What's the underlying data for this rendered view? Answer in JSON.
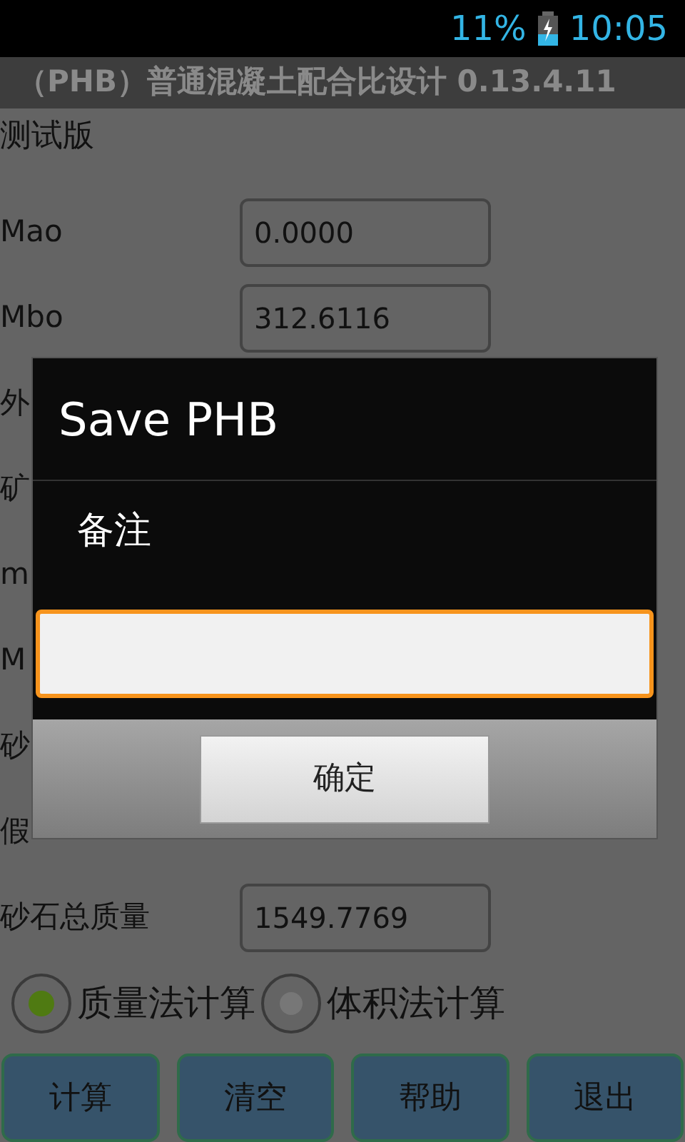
{
  "status_bar": {
    "battery": "11%",
    "time": "10:05"
  },
  "title": "（PHB）普通混凝土配合比设计 0.13.4.11",
  "subtitle": "测试版",
  "rows": [
    {
      "label": "Mao",
      "value": "0.0000"
    },
    {
      "label": "Mbo",
      "value": "312.6116"
    },
    {
      "label": "外"
    },
    {
      "label": "矿"
    },
    {
      "label": "m"
    },
    {
      "label": "M"
    },
    {
      "label": "砂"
    },
    {
      "label": "假"
    },
    {
      "label": "砂石总质量",
      "value": "1549.7769"
    }
  ],
  "radios": [
    {
      "label": "质量法计算",
      "selected": true
    },
    {
      "label": "体积法计算",
      "selected": false
    }
  ],
  "buttons": [
    "计算",
    "清空",
    "帮助",
    "退出"
  ],
  "dialog": {
    "title": "Save PHB",
    "message": "备注",
    "button": "确定"
  }
}
